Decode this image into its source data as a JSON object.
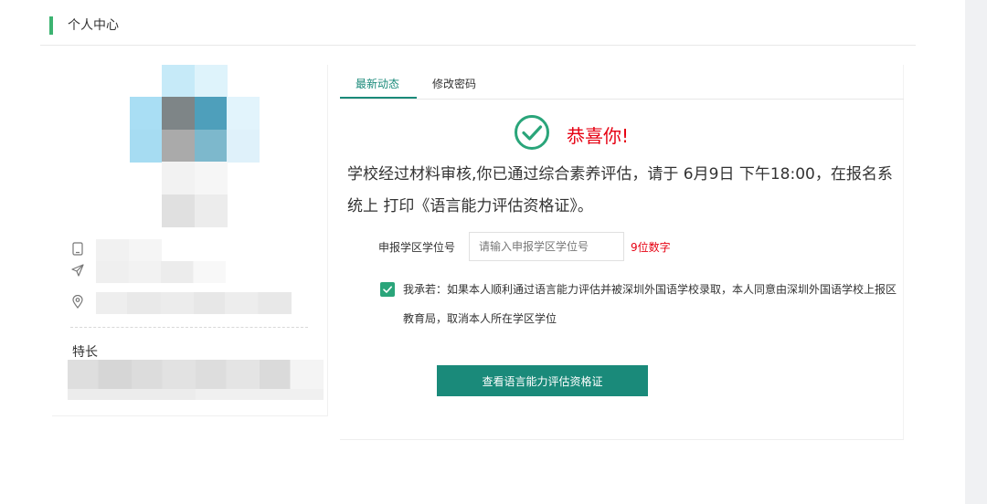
{
  "header": {
    "title": "个人中心"
  },
  "profile": {
    "skills_label": "特长",
    "icons": [
      "phone-icon",
      "send-icon",
      "location-icon"
    ]
  },
  "tabs": [
    {
      "label": "最新动态",
      "active": true
    },
    {
      "label": "修改密码",
      "active": false
    }
  ],
  "notice": {
    "congrats": "恭喜你!",
    "message": "学校经过材料审核,你已通过综合素养评估，请于 6月9日 下午18:00，在报名系统上 打印《语言能力评估资格证》。"
  },
  "form": {
    "label": "申报学区学位号",
    "placeholder": "请输入申报学区学位号",
    "value": "",
    "hint": "9位数字"
  },
  "agreement": {
    "checked": true,
    "text": "我承若：如果本人顺利通过语言能力评估并被深圳外国语学校录取，本人同意由深圳外国语学校上报区教育局，取消本人所在学区学位"
  },
  "button": {
    "label": "查看语言能力评估资格证"
  },
  "colors": {
    "accent": "#1a8a7a",
    "header_bar": "#3cb371",
    "alert": "#e60012",
    "check": "#2aa57a"
  }
}
